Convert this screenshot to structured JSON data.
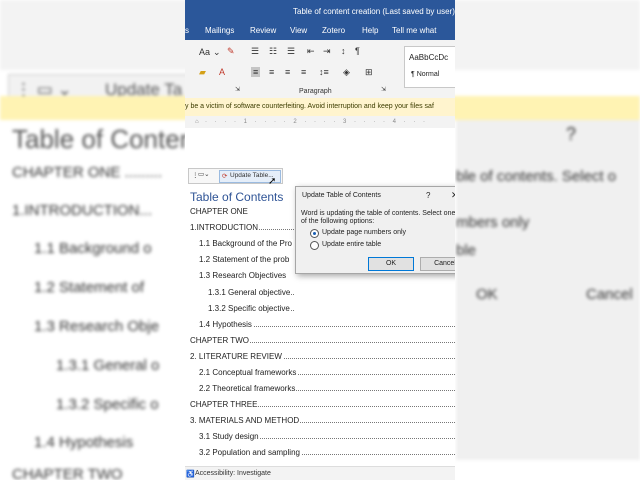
{
  "window": {
    "title": "Table of content creation (Last saved by user) - W"
  },
  "tabs": [
    "s",
    "Mailings",
    "Review",
    "View",
    "Zotero",
    "Help",
    "Tell me what"
  ],
  "ribbon": {
    "styles_sample": "AaBbCcDc",
    "styles_normal": "¶ Normal",
    "paragraph_label": "Paragraph",
    "font_size_label": "Aa",
    "pilcrow": "¶"
  },
  "warning": {
    "text": "y be a victim of software counterfeiting. Avoid interruption and keep your files saf"
  },
  "mini_toolbar": {
    "update_table_label": "Update Table..."
  },
  "toc": {
    "title": "Table of Contents",
    "entries": [
      "CHAPTER ONE",
      "1.INTRODUCTION",
      "1.1 Background of the Pro",
      "1.2 Statement of the prob",
      "1.3 Research Objectives",
      "1.3.1 General objective",
      "1.3.2 Specific objective",
      "1.4 Hypothesis",
      "CHAPTER TWO",
      "2. LITERATURE REVIEW",
      "2.1 Conceptual frameworks",
      "2.2 Theoretical frameworks",
      "CHAPTER THREE",
      "3. MATERIALS AND METHOD",
      "3.1 Study design",
      "3.2 Population and sampling"
    ]
  },
  "dialog": {
    "title": "Update Table of Contents",
    "help": "?",
    "close": "✕",
    "message": "Word is updating the table of contents.  Select one of the following options:",
    "option_page_numbers": "Update page numbers only",
    "option_entire": "Update entire table",
    "selected": "page_numbers",
    "ok_label": "OK",
    "cancel_label": "Cancel"
  },
  "status": {
    "accessibility": "Accessibility: Investigate"
  },
  "background": {
    "toolbar_label": "Update Ta",
    "doc_title": "Table of Conten",
    "doc_lines": [
      "CHAPTER ONE .........",
      "1.INTRODUCTION...",
      "1.1 Background o",
      "1.2 Statement of",
      "1.3 Research Obje",
      "1.3.1 General o",
      "1.3.2 Specific o",
      "1.4 Hypothesis",
      "CHAPTER TWO"
    ],
    "dialog_fragments": [
      "?",
      "ble of contents.  Select o",
      "mbers only",
      "ble",
      "OK",
      "Cancel"
    ]
  }
}
